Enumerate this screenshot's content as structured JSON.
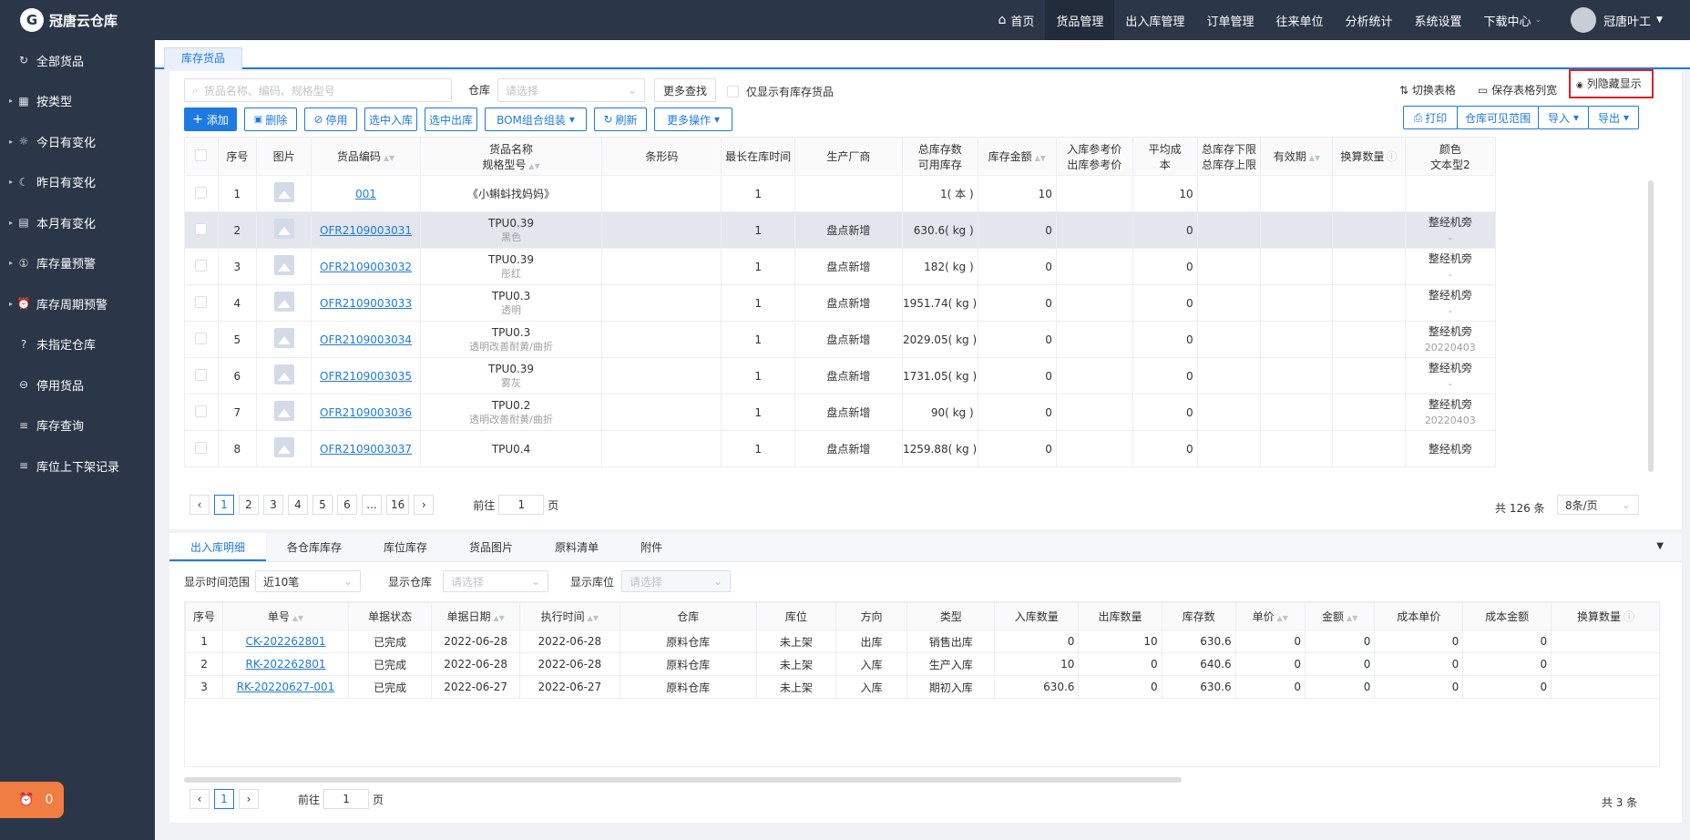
{
  "app": {
    "logo_text": "冠唐云仓库",
    "logo_mark": "G"
  },
  "sidebar": {
    "items": [
      {
        "label": "全部货品",
        "icon": "↻",
        "arrow": ""
      },
      {
        "label": "按类型",
        "icon": "▦",
        "arrow": "▸"
      },
      {
        "label": "今日有变化",
        "icon": "☼",
        "arrow": "▸"
      },
      {
        "label": "昨日有变化",
        "icon": "☾",
        "arrow": "▸"
      },
      {
        "label": "本月有变化",
        "icon": "▤",
        "arrow": "▸"
      },
      {
        "label": "库存量预警",
        "icon": "①",
        "arrow": "▸"
      },
      {
        "label": "库存周期预警",
        "icon": "⏰",
        "arrow": "▸"
      },
      {
        "label": "未指定仓库",
        "icon": "?",
        "arrow": ""
      },
      {
        "label": "停用货品",
        "icon": "⊖",
        "arrow": ""
      },
      {
        "label": "库存查询",
        "icon": "≡",
        "arrow": ""
      },
      {
        "label": "库位上下架记录",
        "icon": "≡",
        "arrow": ""
      }
    ],
    "alarm_icon": "⏰",
    "alarm_count": "0"
  },
  "topnav": {
    "home_icon": "⌂",
    "items": [
      {
        "label": "首页",
        "active": false
      },
      {
        "label": "货品管理",
        "active": true
      },
      {
        "label": "出入库管理",
        "active": false
      },
      {
        "label": "订单管理",
        "active": false
      },
      {
        "label": "往来单位",
        "active": false
      },
      {
        "label": "分析统计",
        "active": false
      },
      {
        "label": "系统设置",
        "active": false
      },
      {
        "label": "下载中心",
        "active": false
      }
    ],
    "user_name": "冠唐叶工",
    "caret": "▼",
    "small_caret": "⌄"
  },
  "tab": {
    "label": "库存货品"
  },
  "toolbar": {
    "search_placeholder": "货品名称、编码、规格型号",
    "warehouse_label": "仓库",
    "warehouse_placeholder": "请选择",
    "more_search": "更多查找",
    "only_stock": "仅显示有库存货品",
    "switch_table": "切换表格",
    "save_widths": "保存表格列宽",
    "column_toggle": "列隐藏显示",
    "add": "添加",
    "delete": "删除",
    "disable": "停用",
    "stock_in": "选中入库",
    "stock_out": "选中出库",
    "bom": "BOM组合组装",
    "refresh": "刷新",
    "more_ops": "更多操作",
    "print": "打印",
    "visible_range": "仓库可见范围",
    "import": "导入",
    "export": "导出"
  },
  "goods_table": {
    "headers": {
      "seq": "序号",
      "img": "图片",
      "code": "货品编码",
      "name1": "货品名称",
      "name2": "规格型号",
      "barcode": "条形码",
      "max_days": "最长在库时间",
      "maker": "生产厂商",
      "stock1": "总库存数",
      "stock2": "可用库存",
      "amount": "库存金额",
      "inprice1": "入库参考价",
      "inprice2": "出库参考价",
      "avg1": "平均成",
      "avg2": "本",
      "limit1": "总库存下限",
      "limit2": "总库存上限",
      "valid": "有效期",
      "conv": "换算数量",
      "color1": "颜色",
      "color2": "文本型2"
    },
    "rows": [
      {
        "seq": "1",
        "code": "001",
        "name": "《小蝌蚪找妈妈》",
        "spec": "",
        "days": "1",
        "maker": "",
        "stock": "1( 本 )",
        "amount": "10",
        "avg": "10",
        "color": "",
        "text2": ""
      },
      {
        "seq": "2",
        "code": "OFR2109003031",
        "name": "TPU0.39",
        "spec": "黑色",
        "days": "1",
        "maker": "盘点新增",
        "stock": "630.6( kg )",
        "amount": "0",
        "avg": "0",
        "color": "整经机旁",
        "text2": "-"
      },
      {
        "seq": "3",
        "code": "OFR2109003032",
        "name": "TPU0.39",
        "spec": "彤红",
        "days": "1",
        "maker": "盘点新增",
        "stock": "182( kg )",
        "amount": "0",
        "avg": "0",
        "color": "整经机旁",
        "text2": "-"
      },
      {
        "seq": "4",
        "code": "OFR2109003033",
        "name": "TPU0.3",
        "spec": "透明",
        "days": "1",
        "maker": "盘点新增",
        "stock": "1951.74( kg )",
        "amount": "0",
        "avg": "0",
        "color": "整经机旁",
        "text2": "-"
      },
      {
        "seq": "5",
        "code": "OFR2109003034",
        "name": "TPU0.3",
        "spec": "透明改善耐黄/曲折",
        "days": "1",
        "maker": "盘点新增",
        "stock": "2029.05( kg )",
        "amount": "0",
        "avg": "0",
        "color": "整经机旁",
        "text2": "20220403"
      },
      {
        "seq": "6",
        "code": "OFR2109003035",
        "name": "TPU0.39",
        "spec": "雾灰",
        "days": "1",
        "maker": "盘点新增",
        "stock": "1731.05( kg )",
        "amount": "0",
        "avg": "0",
        "color": "整经机旁",
        "text2": "-"
      },
      {
        "seq": "7",
        "code": "OFR2109003036",
        "name": "TPU0.2",
        "spec": "透明改善耐黄/曲折",
        "days": "1",
        "maker": "盘点新增",
        "stock": "90( kg )",
        "amount": "0",
        "avg": "0",
        "color": "整经机旁",
        "text2": "20220403"
      },
      {
        "seq": "8",
        "code": "OFR2109003037",
        "name": "TPU0.4",
        "spec": "",
        "days": "1",
        "maker": "盘点新增",
        "stock": "1259.88( kg )",
        "amount": "0",
        "avg": "0",
        "color": "整经机旁",
        "text2": ""
      }
    ]
  },
  "pager_top": {
    "pages": [
      "1",
      "2",
      "3",
      "4",
      "5",
      "6",
      "...",
      "16"
    ],
    "prev": "‹",
    "next": "›",
    "goto_prefix": "前往",
    "goto_value": "1",
    "goto_suffix": "页",
    "total": "共 126 条",
    "page_size": "8条/页"
  },
  "bottom_tabs": [
    "出入库明细",
    "各仓库库存",
    "库位库存",
    "货品图片",
    "原料清单",
    "附件"
  ],
  "bottom_filters": {
    "range_label": "显示时间范围",
    "range_value": "近10笔",
    "wh_label": "显示仓库",
    "wh_placeholder": "请选择",
    "loc_label": "显示库位",
    "loc_placeholder": "请选择"
  },
  "detail_table": {
    "headers": [
      "序号",
      "单号",
      "单据状态",
      "单据日期",
      "执行时间",
      "仓库",
      "库位",
      "方向",
      "类型",
      "入库数量",
      "出库数量",
      "库存数",
      "单价",
      "金额",
      "成本单价",
      "成本金额",
      "换算数量"
    ],
    "rows": [
      [
        "1",
        "CK-202262801",
        "已完成",
        "2022-06-28",
        "2022-06-28",
        "原料仓库",
        "未上架",
        "出库",
        "销售出库",
        "0",
        "10",
        "630.6",
        "0",
        "0",
        "0",
        "0",
        ""
      ],
      [
        "2",
        "RK-202262801",
        "已完成",
        "2022-06-28",
        "2022-06-28",
        "原料仓库",
        "未上架",
        "入库",
        "生产入库",
        "10",
        "0",
        "640.6",
        "0",
        "0",
        "0",
        "0",
        ""
      ],
      [
        "3",
        "RK-20220627-001",
        "已完成",
        "2022-06-27",
        "2022-06-27",
        "原料仓库",
        "未上架",
        "入库",
        "期初入库",
        "630.6",
        "0",
        "630.6",
        "0",
        "0",
        "0",
        "0",
        ""
      ]
    ]
  },
  "pager_bottom": {
    "page": "1",
    "prev": "‹",
    "next": "›",
    "goto_prefix": "前往",
    "goto_value": "1",
    "goto_suffix": "页",
    "total": "共 3 条"
  },
  "icons": {
    "search": "⌕",
    "chevron": "⌄",
    "plus": "+",
    "trash": "🗑",
    "stop": "⊘",
    "refresh": "↻",
    "dropdown": "▾",
    "print": "⎙",
    "eye": "◉",
    "folder": "▭",
    "switch": "⇅",
    "collapse": "▼",
    "info": "ⓘ"
  },
  "colors": {
    "accent": "#1e7ae0",
    "sidebar": "#2b3648",
    "alarm": "#f07d41",
    "highlight": "#e02020"
  }
}
